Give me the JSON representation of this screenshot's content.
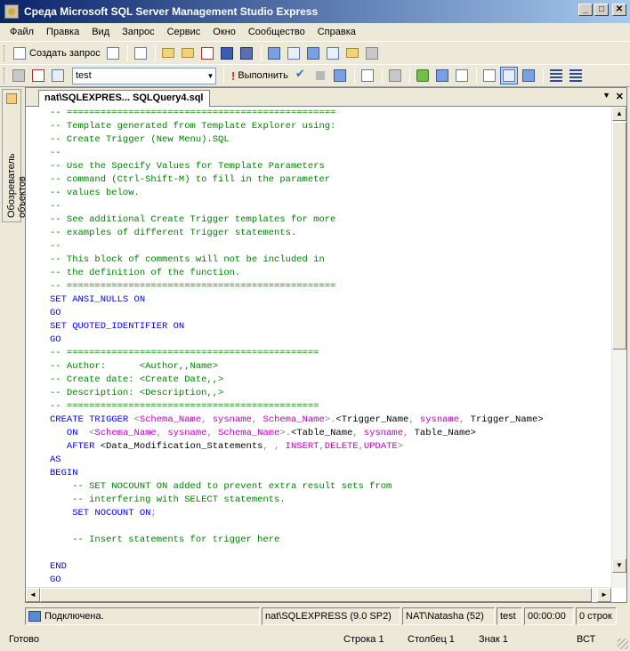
{
  "window": {
    "title": "Среда Microsoft SQL Server Management Studio Express",
    "minimize": "_",
    "maximize": "□",
    "close": "✕"
  },
  "menu": [
    {
      "label": "Файл"
    },
    {
      "label": "Правка"
    },
    {
      "label": "Вид"
    },
    {
      "label": "Запрос"
    },
    {
      "label": "Сервис"
    },
    {
      "label": "Окно"
    },
    {
      "label": "Сообщество"
    },
    {
      "label": "Справка"
    }
  ],
  "toolbar1": {
    "new_query_label": "Создать запрос"
  },
  "toolbar2": {
    "database": "test",
    "execute_label": "Выполнить"
  },
  "side_panel": {
    "label": "Обозреватель объектов"
  },
  "document": {
    "tab_title": "nat\\SQLEXPRES... SQLQuery4.sql",
    "close_glyph": "✕",
    "dropdown_glyph": "▼"
  },
  "code_lines": [
    [
      {
        "c": "c",
        "t": "-- ================================================"
      }
    ],
    [
      {
        "c": "c",
        "t": "-- Template generated from Template Explorer using:"
      }
    ],
    [
      {
        "c": "c",
        "t": "-- Create Trigger (New Menu).SQL"
      }
    ],
    [
      {
        "c": "c",
        "t": "--"
      }
    ],
    [
      {
        "c": "c",
        "t": "-- Use the Specify Values for Template Parameters"
      }
    ],
    [
      {
        "c": "c",
        "t": "-- command (Ctrl-Shift-M) to fill in the parameter"
      }
    ],
    [
      {
        "c": "c",
        "t": "-- values below."
      }
    ],
    [
      {
        "c": "c",
        "t": "--"
      }
    ],
    [
      {
        "c": "c",
        "t": "-- See additional Create Trigger templates for more"
      }
    ],
    [
      {
        "c": "c",
        "t": "-- examples of different Trigger statements."
      }
    ],
    [
      {
        "c": "c",
        "t": "--"
      }
    ],
    [
      {
        "c": "c",
        "t": "-- This block of comments will not be included in"
      }
    ],
    [
      {
        "c": "c",
        "t": "-- the definition of the function."
      }
    ],
    [
      {
        "c": "c",
        "t": "-- ================================================"
      }
    ],
    [
      {
        "c": "k",
        "t": "SET ANSI_NULLS ON"
      }
    ],
    [
      {
        "c": "k",
        "t": "GO"
      }
    ],
    [
      {
        "c": "k",
        "t": "SET QUOTED_IDENTIFIER ON"
      }
    ],
    [
      {
        "c": "k",
        "t": "GO"
      }
    ],
    [
      {
        "c": "c",
        "t": "-- ============================================="
      }
    ],
    [
      {
        "c": "c",
        "t": "-- Author:\t\t<Author,,Name>"
      }
    ],
    [
      {
        "c": "c",
        "t": "-- Create date: <Create Date,,>"
      }
    ],
    [
      {
        "c": "c",
        "t": "-- Description: <Description,,>"
      }
    ],
    [
      {
        "c": "c",
        "t": "-- ============================================="
      }
    ],
    [
      {
        "c": "k",
        "t": "CREATE TRIGGER "
      },
      {
        "c": "p",
        "t": "<"
      },
      {
        "c": "m",
        "t": "Schema_Name"
      },
      {
        "c": "p",
        "t": ", "
      },
      {
        "c": "m",
        "t": "sysname"
      },
      {
        "c": "p",
        "t": ", "
      },
      {
        "c": "m",
        "t": "Schema_Name"
      },
      {
        "c": "p",
        "t": ">."
      },
      {
        "c": "t",
        "t": "<Trigger_Name"
      },
      {
        "c": "p",
        "t": ", "
      },
      {
        "c": "m",
        "t": "sysname"
      },
      {
        "c": "p",
        "t": ", "
      },
      {
        "c": "t",
        "t": "Trigger_Name>"
      }
    ],
    [
      {
        "c": "k",
        "t": "   ON  "
      },
      {
        "c": "p",
        "t": "<"
      },
      {
        "c": "m",
        "t": "Schema_Name"
      },
      {
        "c": "p",
        "t": ", "
      },
      {
        "c": "m",
        "t": "sysname"
      },
      {
        "c": "p",
        "t": ", "
      },
      {
        "c": "m",
        "t": "Schema_Name"
      },
      {
        "c": "p",
        "t": ">."
      },
      {
        "c": "t",
        "t": "<Table_Name"
      },
      {
        "c": "p",
        "t": ", "
      },
      {
        "c": "m",
        "t": "sysname"
      },
      {
        "c": "p",
        "t": ", "
      },
      {
        "c": "t",
        "t": "Table_Name>"
      }
    ],
    [
      {
        "c": "k",
        "t": "   AFTER "
      },
      {
        "c": "t",
        "t": "<Data_Modification_Statements"
      },
      {
        "c": "p",
        "t": ", , "
      },
      {
        "c": "m",
        "t": "INSERT"
      },
      {
        "c": "p",
        "t": ","
      },
      {
        "c": "m",
        "t": "DELETE"
      },
      {
        "c": "p",
        "t": ","
      },
      {
        "c": "m",
        "t": "UPDATE"
      },
      {
        "c": "p",
        "t": ">"
      }
    ],
    [
      {
        "c": "k",
        "t": "AS"
      }
    ],
    [
      {
        "c": "k",
        "t": "BEGIN"
      }
    ],
    [
      {
        "c": "c",
        "t": "    -- SET NOCOUNT ON added to prevent extra result sets from"
      }
    ],
    [
      {
        "c": "c",
        "t": "    -- interfering with SELECT statements."
      }
    ],
    [
      {
        "c": "k",
        "t": "    SET NOCOUNT ON"
      },
      {
        "c": "p",
        "t": ";"
      }
    ],
    [
      {
        "c": "t",
        "t": ""
      }
    ],
    [
      {
        "c": "c",
        "t": "    -- Insert statements for trigger here"
      }
    ],
    [
      {
        "c": "t",
        "t": ""
      }
    ],
    [
      {
        "c": "k",
        "t": "END"
      }
    ],
    [
      {
        "c": "k",
        "t": "GO"
      }
    ]
  ],
  "connection_bar": {
    "status": "Подключена.",
    "server": "nat\\SQLEXPRESS (9.0 SP2)",
    "user": "NAT\\Natasha (52)",
    "database": "test",
    "elapsed": "00:00:00",
    "rows": "0 строк"
  },
  "status_bar": {
    "ready": "Готово",
    "row": "Строка 1",
    "column": "Столбец 1",
    "char": "Знак 1",
    "mode": "ВСТ"
  },
  "colors": {
    "comment": "#008000",
    "keyword": "#0000FF",
    "punctuation": "#808080",
    "sysname": "#C000C0",
    "titlebar_start": "#0A246A",
    "titlebar_end": "#A6CAF0",
    "chrome": "#ECE9D8"
  }
}
